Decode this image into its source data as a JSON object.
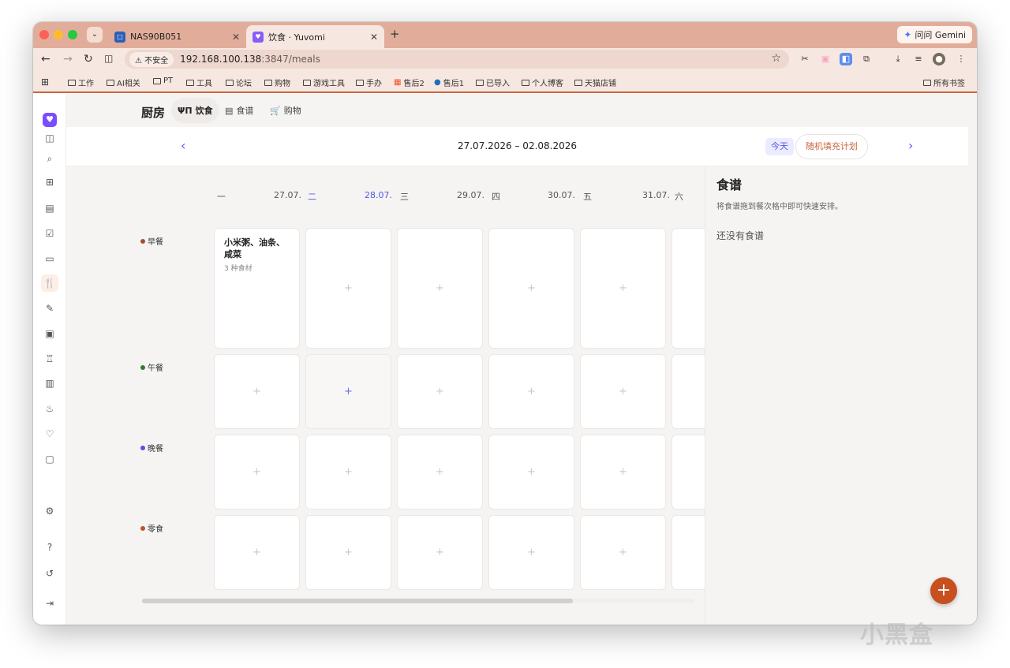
{
  "browser": {
    "tabs": [
      {
        "title": "NAS90B051",
        "favicon": "nas-favicon"
      },
      {
        "title": "饮食 · Yuvomi",
        "favicon": "yuvomi-favicon"
      }
    ],
    "gemini_label": "问问 Gemini",
    "insecure_label": "不安全",
    "url_host": "192.168.100.138",
    "url_path": ":3847/meals",
    "bookmarks": [
      "工作",
      "AI相关",
      "PT",
      "工具",
      "论坛",
      "购物",
      "游戏工具",
      "手办",
      "售后2",
      "售后1",
      "已导入",
      "个人博客",
      "天猫店铺"
    ],
    "all_bookmarks": "所有书签"
  },
  "app": {
    "title": "厨房",
    "subtabs": [
      "饮食",
      "食谱",
      "购物"
    ],
    "week_range": "27.07.2026 – 02.08.2026",
    "today_label": "今天",
    "random_fill_label": "随机填充计划",
    "days": [
      {
        "weekday": "一",
        "date": "27.07."
      },
      {
        "weekday": "二",
        "date": "28.07."
      },
      {
        "weekday": "三",
        "date": "29.07."
      },
      {
        "weekday": "四",
        "date": "30.07."
      },
      {
        "weekday": "五",
        "date": "31.07."
      },
      {
        "weekday": "六",
        "date": ""
      }
    ],
    "meals": [
      {
        "label": "早餐",
        "color": "#a0522d"
      },
      {
        "label": "午餐",
        "color": "#2e7d32"
      },
      {
        "label": "晚餐",
        "color": "#5b4fe0"
      },
      {
        "label": "零食",
        "color": "#c0561e"
      }
    ],
    "filled_entry": {
      "name": "小米粥、油条、咸菜",
      "sub": "3 种食材"
    },
    "add_glyph": "+",
    "recipes": {
      "title": "食谱",
      "hint": "将食谱拖到餐次格中即可快速安排。",
      "empty": "还没有食谱"
    }
  },
  "watermark": "小黑盒"
}
